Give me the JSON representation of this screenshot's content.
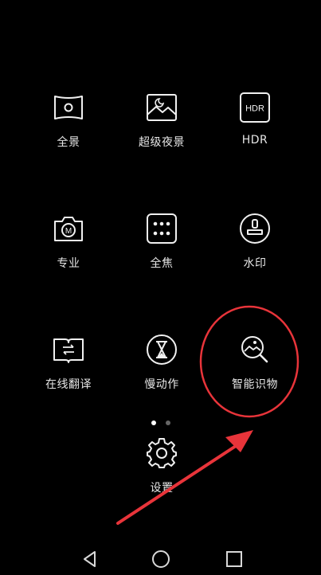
{
  "modes": [
    {
      "id": "panorama",
      "label": "全景",
      "icon": "panorama-icon"
    },
    {
      "id": "night",
      "label": "超级夜景",
      "icon": "night-scene-icon"
    },
    {
      "id": "hdr",
      "label": "HDR",
      "icon": "hdr-icon",
      "icon_text": "HDR"
    },
    {
      "id": "pro",
      "label": "专业",
      "icon": "pro-camera-icon",
      "icon_text": "M"
    },
    {
      "id": "allfocus",
      "label": "全焦",
      "icon": "all-focus-icon"
    },
    {
      "id": "watermark",
      "label": "水印",
      "icon": "watermark-stamp-icon"
    },
    {
      "id": "translate",
      "label": "在线翻译",
      "icon": "translate-book-icon"
    },
    {
      "id": "slowmo",
      "label": "慢动作",
      "icon": "hourglass-icon"
    },
    {
      "id": "recognition",
      "label": "智能识物",
      "icon": "image-search-icon"
    }
  ],
  "settings": {
    "label": "设置",
    "icon": "gear-icon"
  },
  "pagination": {
    "pages": 2,
    "current": 1
  },
  "navbar": {
    "back": "back-triangle-icon",
    "home": "home-circle-icon",
    "recents": "recents-square-icon"
  },
  "annotation": {
    "color": "#e8343a",
    "target": "智能识物"
  },
  "colors": {
    "background": "#000000",
    "text": "#e6e6e6",
    "icon": "#f0f0f0",
    "annotation": "#e8343a"
  }
}
